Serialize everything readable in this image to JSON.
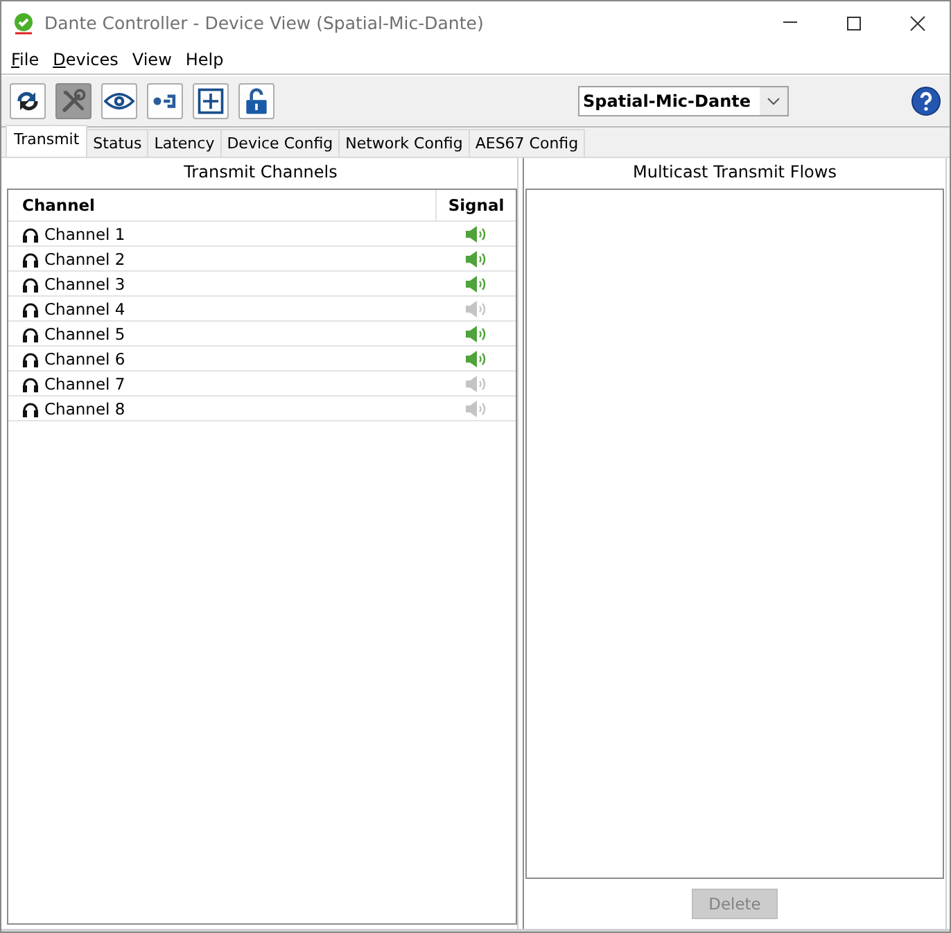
{
  "window": {
    "title": "Dante Controller - Device View (Spatial-Mic-Dante)"
  },
  "menu": [
    {
      "label": "File",
      "underlined": true
    },
    {
      "label": "Devices",
      "underlined": true
    },
    {
      "label": "View",
      "underlined": false
    },
    {
      "label": "Help",
      "underlined": false
    }
  ],
  "toolbar": {
    "buttons": [
      {
        "kind": "refresh",
        "disabled": false
      },
      {
        "kind": "tools",
        "disabled": true
      },
      {
        "kind": "eye",
        "disabled": false
      },
      {
        "kind": "connect",
        "disabled": false
      },
      {
        "kind": "add",
        "disabled": false
      },
      {
        "kind": "lock",
        "disabled": false
      }
    ],
    "device_select": {
      "value": "Spatial-Mic-Dante"
    }
  },
  "tabs": [
    {
      "label": "Transmit",
      "selected": true
    },
    {
      "label": "Status",
      "selected": false
    },
    {
      "label": "Latency",
      "selected": false
    },
    {
      "label": "Device Config",
      "selected": false
    },
    {
      "label": "Network Config",
      "selected": false
    },
    {
      "label": "AES67 Config",
      "selected": false
    }
  ],
  "transmit_channels": {
    "title": "Transmit Channels",
    "columns": [
      "Channel",
      "Signal"
    ],
    "rows": [
      {
        "name": "Channel 1",
        "signal": true
      },
      {
        "name": "Channel 2",
        "signal": true
      },
      {
        "name": "Channel 3",
        "signal": true
      },
      {
        "name": "Channel 4",
        "signal": false
      },
      {
        "name": "Channel 5",
        "signal": true
      },
      {
        "name": "Channel 6",
        "signal": true
      },
      {
        "name": "Channel 7",
        "signal": false
      },
      {
        "name": "Channel 8",
        "signal": false
      }
    ]
  },
  "multicast_flows": {
    "title": "Multicast Transmit Flows",
    "delete_button": {
      "label": "Delete",
      "disabled": true
    }
  }
}
